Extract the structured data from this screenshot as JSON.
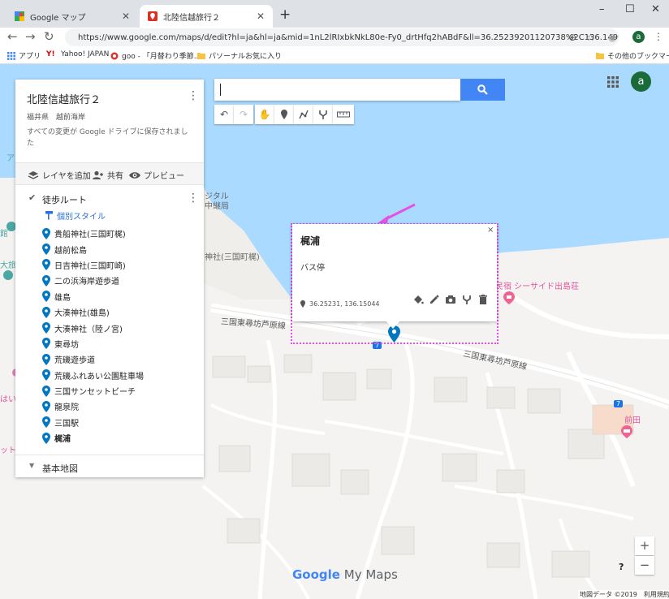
{
  "browser": {
    "tabs": [
      {
        "title": "Google マップ",
        "active": false
      },
      {
        "title": "北陸信越旅行２",
        "active": true
      }
    ],
    "new_tab": "+",
    "window_controls": [
      "–",
      "☐",
      "✕"
    ],
    "url": "https://www.google.com/maps/d/edit?hl=ja&hl=ja&mid=1nL2lRIxbkNkL80e-Fy0_drtHfq2hABdF&ll=36.25239201120738%2C136.1499208...",
    "profile_letter": "a",
    "bookmarks": {
      "apps_label": "アプリ",
      "items": [
        "Yahoo! JAPAN",
        "goo - 「月替わり季節...",
        "パソーナルお気に入り"
      ],
      "other": "その他のブックマーク"
    }
  },
  "map_panel": {
    "title": "北陸信越旅行２",
    "subtitle": "福井県　越前海岸",
    "saved_note": "すべての変更が Google ドライブに保存されました",
    "actions": {
      "add_layer": "レイヤを追加",
      "share": "共有",
      "preview": "プレビュー"
    },
    "layer": {
      "name": "徒歩ルート",
      "style_link": "個別スタイル",
      "places": [
        "貴船神社(三国町梶)",
        "越前松島",
        "日吉神社(三国町崎)",
        "二の浜海岸遊歩道",
        "雄島",
        "大湊神社(雄島)",
        "大湊神社（陸ノ宮)",
        "東尋坊",
        "荒磯遊歩道",
        "荒磯ふれあい公園駐車場",
        "三国サンセットビーチ",
        "龍泉院",
        "三国駅",
        "梶浦"
      ],
      "selected_place": "梶浦"
    },
    "base_map_label": "基本地図"
  },
  "search": {
    "placeholder": ""
  },
  "info_window": {
    "name": "梶浦",
    "description": "バス停",
    "coordinates": "36.25231, 136.15044",
    "close": "×"
  },
  "map_labels": {
    "road_1": "三国東尋坊芦原線",
    "road_2": "三国東尋坊芦原線",
    "poi_hotel": "民宿 シーサイド出島荘",
    "poi_left_1": "ジタル",
    "poi_left_2": "中継局",
    "poi_left_3": "神社(三国町梶)",
    "poi_maeda": "前田",
    "route_badge": "7",
    "edge_a": "ア",
    "edge_kan": "館",
    "edge_dai": "大旅",
    "edge_hai": "はい",
    "edge_ssho": "ット"
  },
  "map_controls": {
    "zoom_in": "+",
    "zoom_out": "−",
    "help": "?"
  },
  "brand": {
    "google": "Google",
    "my_maps": "My Maps"
  },
  "footer": "地図データ ©2019　利用規約",
  "colors": {
    "accent": "#4285f4",
    "pin": "#0277bd",
    "water": "#aadaff",
    "highlight": "#e650e6",
    "hotel_pin": "#f06292"
  }
}
